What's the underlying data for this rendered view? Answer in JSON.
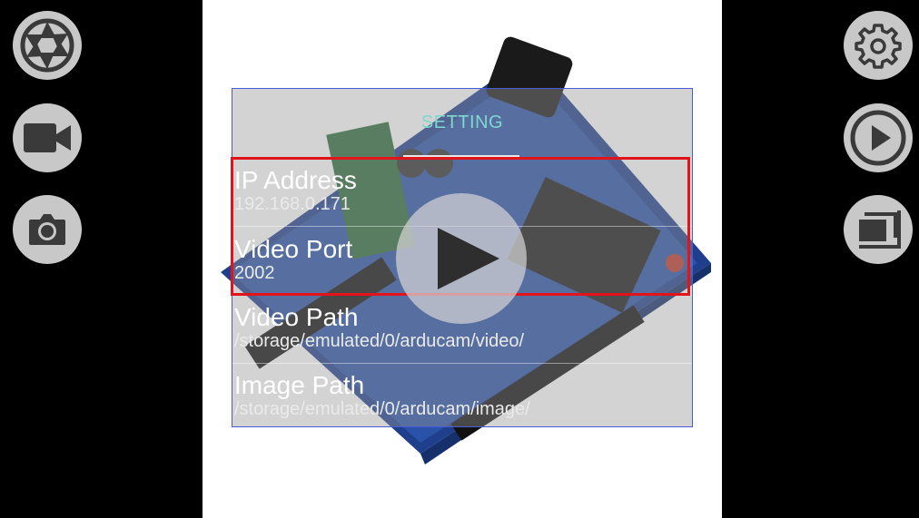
{
  "settings": {
    "title": "SETTING",
    "rows": [
      {
        "label": "IP Address",
        "value": "192.168.0.171"
      },
      {
        "label": "Video Port",
        "value": "2002"
      },
      {
        "label": "Video Path",
        "value": "/storage/emulated/0/arducam/video/"
      },
      {
        "label": "Image Path",
        "value": "/storage/emulated/0/arducam/image/"
      }
    ]
  },
  "left_toolbar": [
    "aperture-icon",
    "video-camera-icon",
    "camera-icon"
  ],
  "right_toolbar": [
    "gear-icon",
    "play-icon",
    "gallery-icon"
  ],
  "colors": {
    "title": "#7fd8cf",
    "highlight": "#e3131b",
    "panel_border": "#4a5ad8"
  }
}
